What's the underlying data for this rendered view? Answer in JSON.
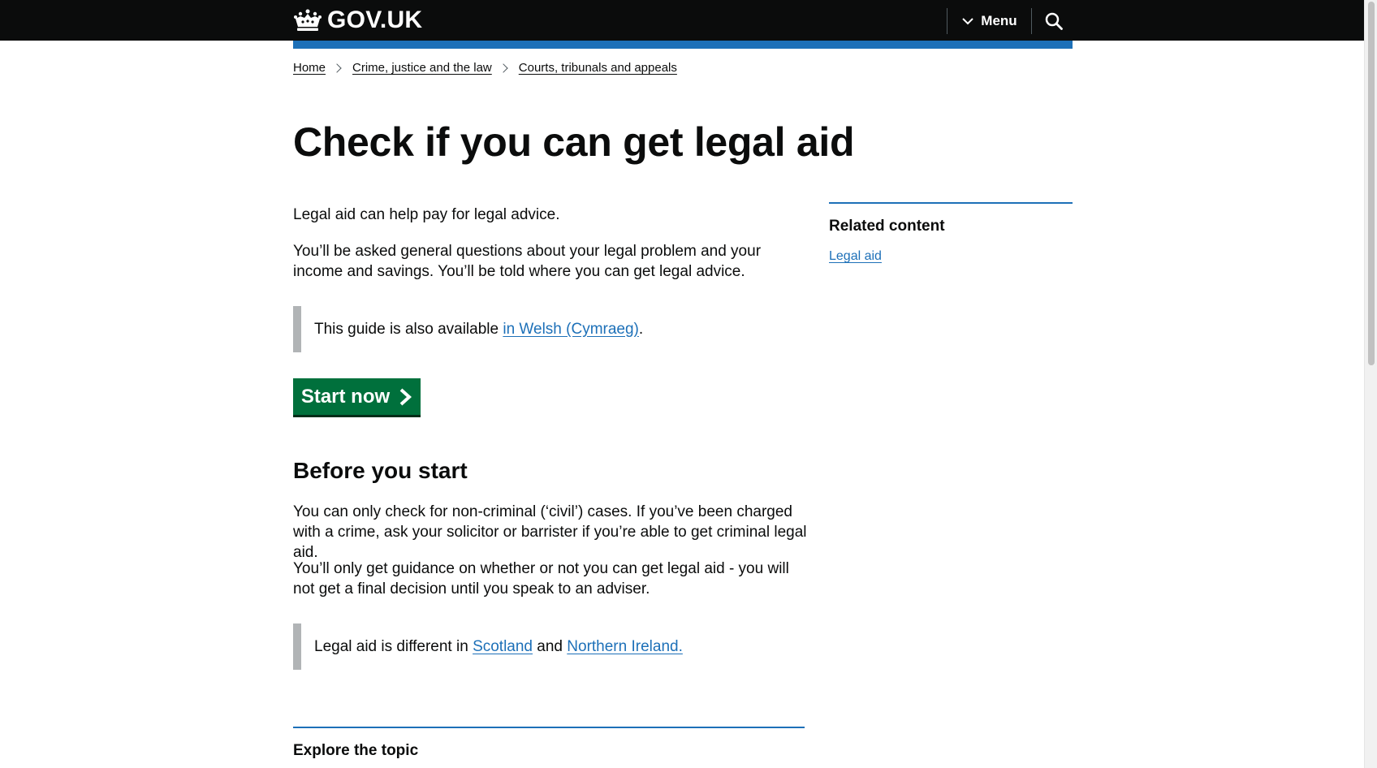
{
  "header": {
    "logo_text": "GOV.UK",
    "menu_label": "Menu",
    "search_label": "Search"
  },
  "breadcrumbs": [
    "Home",
    "Crime, justice and the law",
    "Courts, tribunals and appeals"
  ],
  "main": {
    "title": "Check if you can get legal aid",
    "intro": [
      "Legal aid can help pay for legal advice.",
      "You’ll be asked general questions about your legal problem and your income and savings. You’ll be told where you can get legal advice."
    ],
    "welsh_inset": {
      "text_before": "This guide is also available ",
      "link_text": "in Welsh (Cymraeg)",
      "text_after": "."
    },
    "start_button_label": "Start now",
    "before_heading": "Before you start",
    "before_paragraphs": [
      "You can only check for non-criminal (‘civil’) cases. If you’ve been charged with a crime, ask your solicitor or barrister if you’re able to get criminal legal aid.",
      "You’ll only get guidance on whether or not you can get legal aid - you will not get a final decision until you speak to an adviser."
    ],
    "regions_inset": {
      "text_before": "Legal aid is different in ",
      "link1": "Scotland",
      "text_middle": " and ",
      "link2": "Northern Ireland."
    },
    "explore_heading": "Explore the topic"
  },
  "sidebar": {
    "related_heading": "Related content",
    "related_links": [
      "Legal aid"
    ]
  },
  "colors": {
    "header_bg": "#0b0c0c",
    "accent_blue": "#1d70b8",
    "start_button": "#00703c",
    "inset_border": "#b1b4b6"
  }
}
